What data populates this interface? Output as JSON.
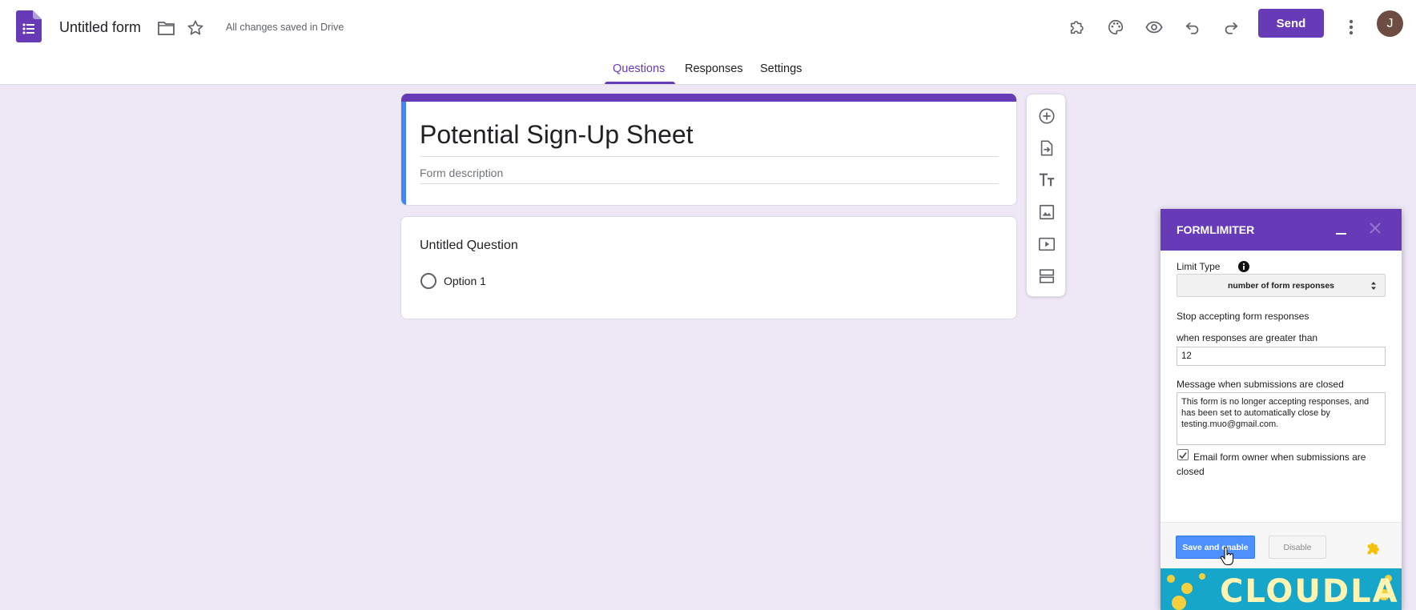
{
  "header": {
    "doc_title": "Untitled form",
    "save_status": "All changes saved in Drive",
    "send_label": "Send",
    "avatar_initial": "J"
  },
  "tabs": [
    {
      "label": "Questions",
      "active": true
    },
    {
      "label": "Responses",
      "active": false
    },
    {
      "label": "Settings",
      "active": false
    }
  ],
  "form": {
    "title": "Potential Sign-Up Sheet",
    "description_placeholder": "Form description",
    "question": {
      "title": "Untitled Question",
      "options": [
        "Option 1"
      ]
    }
  },
  "side_toolbar": {
    "tools": [
      "add-question-icon",
      "import-questions-icon",
      "add-title-icon",
      "add-image-icon",
      "add-video-icon",
      "add-section-icon"
    ]
  },
  "formlimiter": {
    "title": "FORMLIMITER",
    "limit_type_label": "Limit Type",
    "limit_type_value": "number of form responses",
    "stop_label": "Stop accepting form responses",
    "when_label": "when responses are greater than",
    "limit_value": "12",
    "message_label": "Message when submissions are closed",
    "message_value": "This form is no longer accepting responses, and has been set to automatically close by testing.muo@gmail.com.",
    "email_owner_label": "Email form owner when submissions are closed",
    "email_owner_checked": true,
    "save_label": "Save and enable",
    "disable_label": "Disable",
    "banner_text": "CLOUDLAB"
  },
  "colors": {
    "brand_purple": "#673ab7",
    "background": "#ede7f6",
    "accent_blue": "#4285f4",
    "save_button_blue": "#4d90fe",
    "banner_teal": "#16a6c9"
  }
}
